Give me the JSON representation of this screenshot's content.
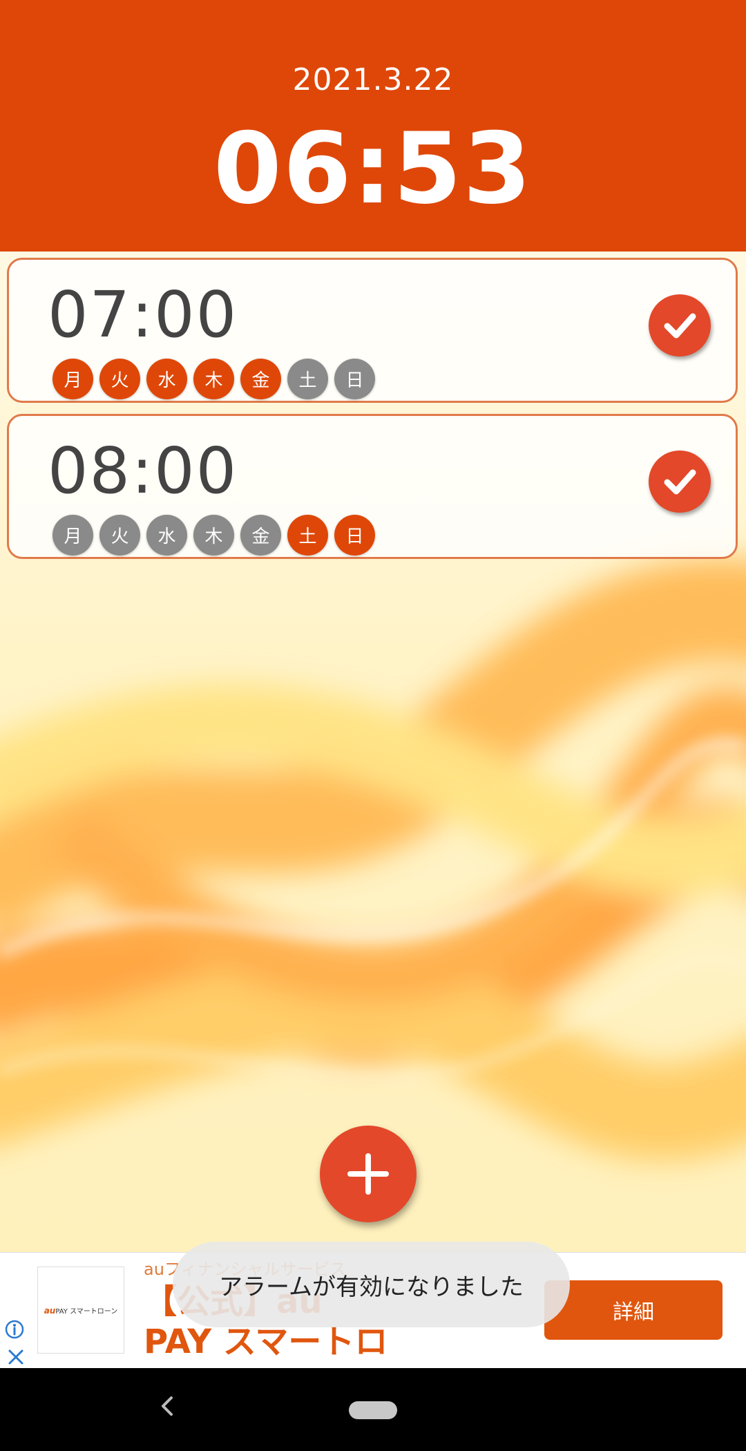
{
  "header": {
    "date": "2021.3.22",
    "current_time": "06:53"
  },
  "alarms": [
    {
      "time": "07:00",
      "enabled": true,
      "days": [
        {
          "label": "月",
          "active": true
        },
        {
          "label": "火",
          "active": true
        },
        {
          "label": "水",
          "active": true
        },
        {
          "label": "木",
          "active": true
        },
        {
          "label": "金",
          "active": true
        },
        {
          "label": "土",
          "active": false
        },
        {
          "label": "日",
          "active": false
        }
      ]
    },
    {
      "time": "08:00",
      "enabled": true,
      "days": [
        {
          "label": "月",
          "active": false
        },
        {
          "label": "火",
          "active": false
        },
        {
          "label": "水",
          "active": false
        },
        {
          "label": "木",
          "active": false
        },
        {
          "label": "金",
          "active": false
        },
        {
          "label": "土",
          "active": true
        },
        {
          "label": "日",
          "active": true
        }
      ]
    }
  ],
  "fab": {
    "icon": "plus-icon"
  },
  "ad": {
    "sponsor": "auフィナンシャルサービス",
    "title": "【公式】au PAY スマートローン",
    "button_label": "詳細",
    "logo_brand": "au",
    "logo_text": "PAY スマートローン"
  },
  "toast": {
    "message": "アラームが有効になりました"
  },
  "colors": {
    "accent": "#df4708",
    "day_inactive": "#8a8a8a",
    "check": "#e3482a"
  }
}
